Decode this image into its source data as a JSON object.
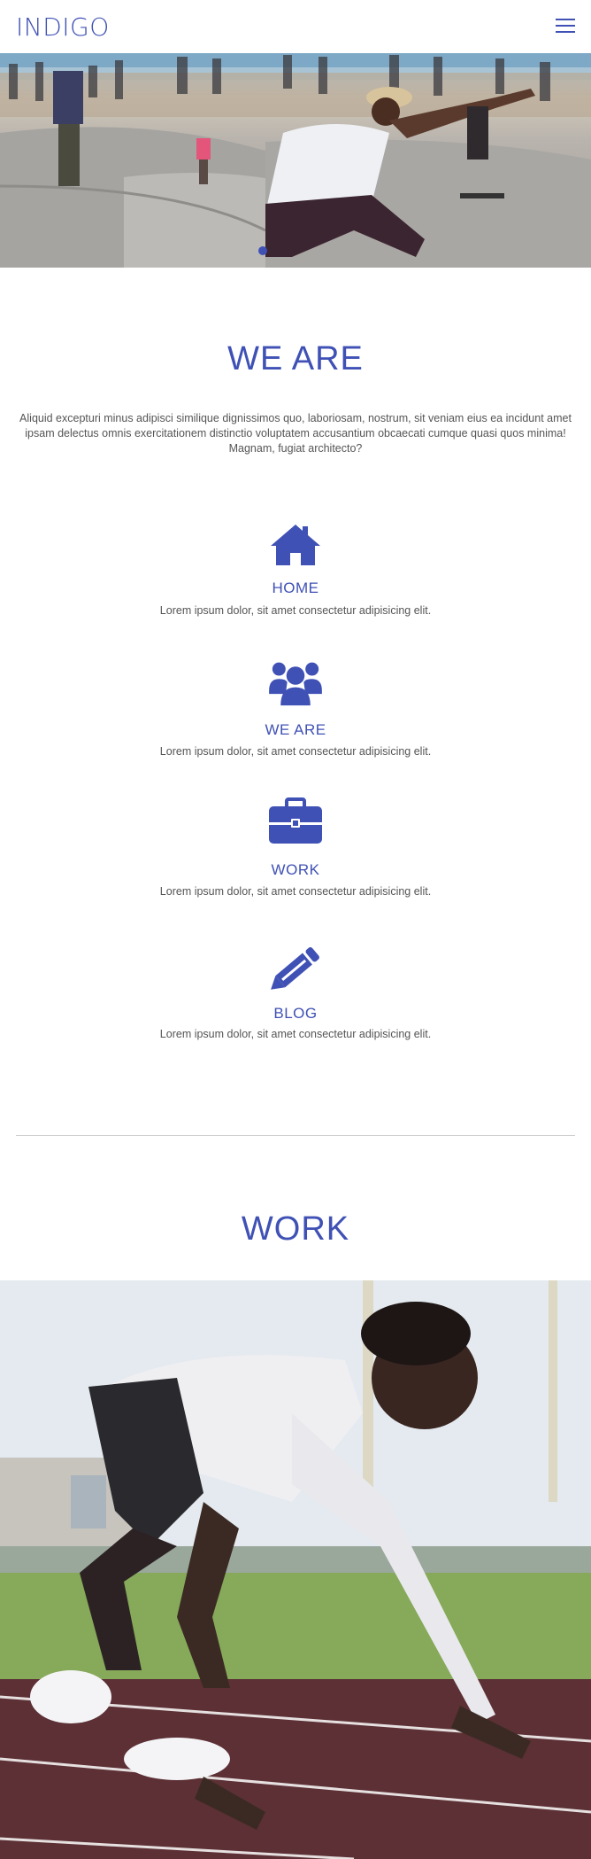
{
  "header": {
    "logo": "INDIGO",
    "menu_icon": "hamburger-menu-icon"
  },
  "hero": {
    "image": "skateboarder-photo",
    "slides_total": 1,
    "active_slide": 1
  },
  "we_are": {
    "title": "WE ARE",
    "text": "Aliquid excepturi minus adipisci similique dignissimos quo, laboriosam, nostrum, sit veniam eius ea incidunt amet ipsam delectus omnis exercitationem distinctio voluptatem accusantium obcaecati cumque quasi quos minima! Magnam, fugiat architecto?"
  },
  "features": [
    {
      "icon": "home-icon",
      "title": "HOME",
      "text": "Lorem ipsum dolor, sit amet consectetur adipisicing elit."
    },
    {
      "icon": "users-icon",
      "title": "WE ARE",
      "text": "Lorem ipsum dolor, sit amet consectetur adipisicing elit."
    },
    {
      "icon": "briefcase-icon",
      "title": "WORK",
      "text": "Lorem ipsum dolor, sit amet consectetur adipisicing elit."
    },
    {
      "icon": "pencil-icon",
      "title": "BLOG",
      "text": "Lorem ipsum dolor, sit amet consectetur adipisicing elit."
    }
  ],
  "work": {
    "title": "WORK",
    "image": "sprinter-photo"
  },
  "colors": {
    "accent": "#3f51b5",
    "text": "#555555",
    "divider": "#cfcfcf"
  }
}
